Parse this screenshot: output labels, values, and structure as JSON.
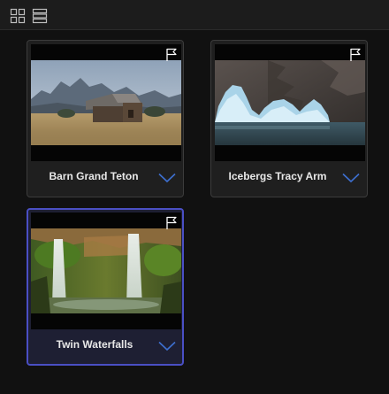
{
  "toolbar": {
    "grid_view_icon": "grid-view-icon",
    "list_view_icon": "list-view-icon"
  },
  "cards": [
    {
      "title": "Barn Grand Teton",
      "selected": false,
      "flag_icon": "flag-icon",
      "menu_icon": "chevron-down-icon"
    },
    {
      "title": "Icebergs Tracy Arm",
      "selected": false,
      "flag_icon": "flag-icon",
      "menu_icon": "chevron-down-icon"
    },
    {
      "title": "Twin Waterfalls",
      "selected": true,
      "flag_icon": "flag-icon",
      "menu_icon": "chevron-down-icon"
    }
  ],
  "colors": {
    "accent": "#4a4fc4",
    "chevron": "#3d6fd0",
    "card_bg": "#1f1f1f",
    "selected_bg": "#1e1f33"
  }
}
